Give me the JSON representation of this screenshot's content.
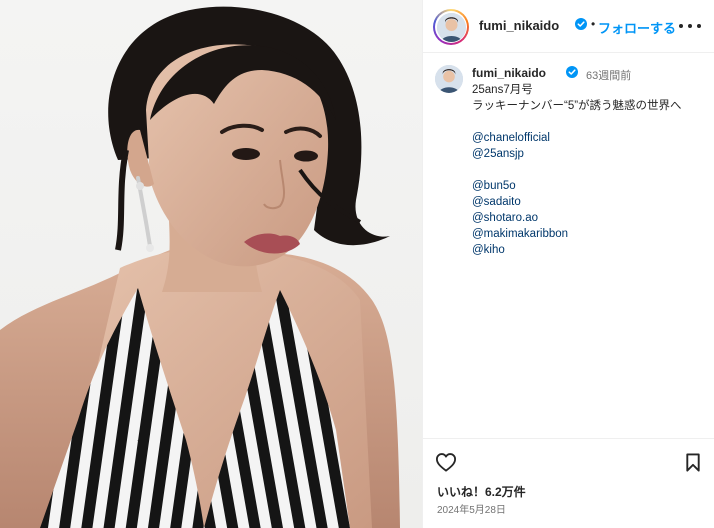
{
  "post": {
    "username": "fumi_nikaido",
    "follow_label": "フォローする",
    "separator": "•",
    "time_ago": "63週間前",
    "caption_lines": [
      "25ans7月号",
      "ラッキーナンバー“5”が誘う魅惑の世界へ"
    ],
    "tags_group1": [
      "@chanelofficial",
      "@25ansjp"
    ],
    "tags_group2": [
      "@bun5o",
      "@sadaito",
      "@shotaro.ao",
      "@makimakaribbon",
      "@kiho"
    ],
    "likes": "いいね！6.2万件",
    "date": "2024年5月28日"
  },
  "icons": {
    "verified": "verified-badge-icon",
    "more": "more-options-icon",
    "like": "heart-icon",
    "save": "bookmark-icon"
  },
  "colors": {
    "accent": "#0095f6",
    "verified": "#0095f6",
    "tag": "#00376b",
    "text": "#262626",
    "muted": "#737373"
  }
}
